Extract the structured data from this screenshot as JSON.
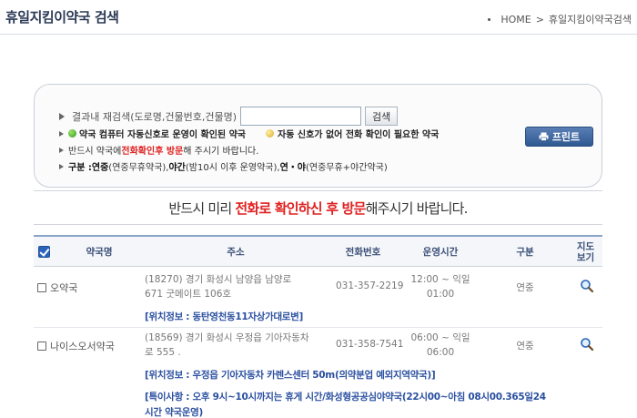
{
  "header": {
    "title": "휴일지킴이약국 검색",
    "breadcrumb": {
      "home": "HOME",
      "separator": ">",
      "current": "휴일지킴이약국검색"
    }
  },
  "search": {
    "label": "결과내 재검색(도로명,건물번호,건물명)",
    "value": "",
    "button_label": "검색",
    "legend_green": "약국 컴퓨터 자동신호로 운영이 확인된 약국",
    "legend_yellow": "자동 신호가 없어 전화 확인이 필요한 약국",
    "notice_prefix": "반드시 약국에 ",
    "notice_highlight": "전화확인후 방문",
    "notice_suffix": "해 주시기 바랍니다.",
    "kind_label": "구분 : ",
    "kind_text_1": "연중",
    "kind_text_1b": "(연중무휴약국), ",
    "kind_text_2": "야간",
    "kind_text_2b": "(밤10시 이후 운영약국), ",
    "kind_text_3": "연・야",
    "kind_text_3b": "(연중무휴+야간약국)",
    "print_label": "프린트"
  },
  "notice_main": {
    "prefix": "반드시 미리 ",
    "highlight": "전화로 확인하신 후 방문",
    "suffix": "해주시기 바랍니다."
  },
  "table": {
    "headers": {
      "name": "약국명",
      "address": "주소",
      "phone": "전화번호",
      "hours": "운영시간",
      "kind": "구분",
      "map_1": "지도",
      "map_2": "보기"
    },
    "rows": [
      {
        "name": "오약국",
        "address_1": "(18270) 경기 화성시 남양읍 남양로",
        "address_2": "671 굿메이트 106호",
        "phone": "031-357-2219",
        "hours_1": "12:00 ~ 익일",
        "hours_2": "01:00",
        "kind": "연중",
        "location": "[위치정보 : 동탄영천동11자상가대로변]"
      },
      {
        "name": "나이스오서약국",
        "address_1": "(18569) 경기 화성시 우정읍 기아자동차",
        "address_2": "로 555 .",
        "phone": "031-358-7541",
        "hours_1": "06:00 ~ 익일",
        "hours_2": "06:00",
        "kind": "연중",
        "location": "[위치정보 : 우정읍 기아자동차 카렌스센터 50m(의약분업 예외지역약국)]",
        "special_1": "[특이사항 : 오후 9시~10시까지는 휴게 시간/화성형공공심야약국(22시00~아침 08시00.365일24",
        "special_2": "시간 약국운영)"
      }
    ]
  },
  "colors": {
    "accent": "#2a63b8",
    "highlight_red": "#e02020",
    "link_blue": "#2a4fa0",
    "title_navy": "#2b3a55"
  },
  "icons": {
    "green_dot": "green-status-dot-icon",
    "yellow_dot": "yellow-status-dot-icon",
    "printer": "printer-icon",
    "map": "magnifier-icon"
  }
}
